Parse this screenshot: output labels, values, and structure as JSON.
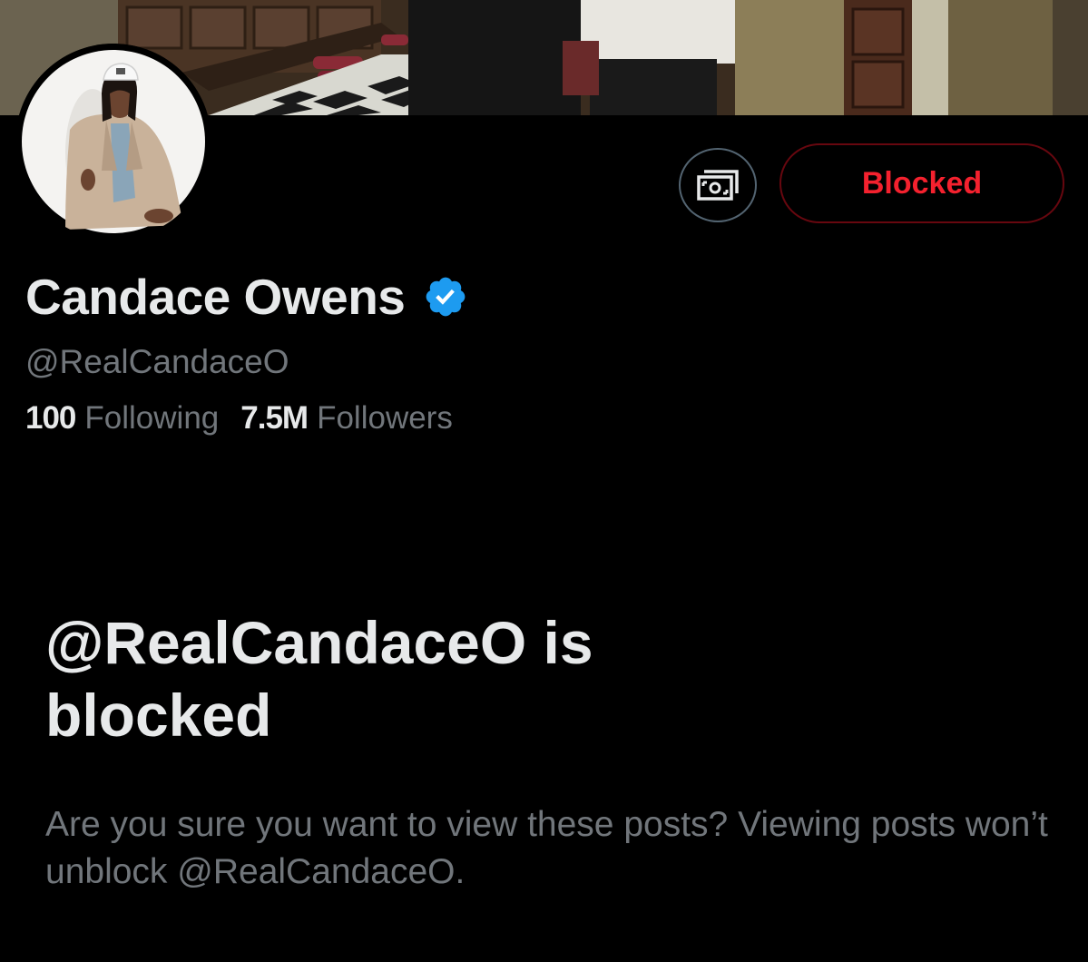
{
  "profile": {
    "display_name": "Candace Owens",
    "handle": "@RealCandaceO",
    "verified": true,
    "following_count": "100",
    "following_label": "Following",
    "followers_count": "7.5M",
    "followers_label": "Followers"
  },
  "actions": {
    "tip_icon": "money-icon",
    "blocked_label": "Blocked"
  },
  "notice": {
    "title": "@RealCandaceO is blocked",
    "message": "Are you sure you want to view these posts? Viewing posts won’t unblock @RealCandaceO."
  },
  "colors": {
    "background": "#000000",
    "primary_text": "#e7e9ea",
    "secondary_text": "#71767b",
    "blocked_red": "#f4212e",
    "blocked_border": "#67070f",
    "verified_blue": "#1d9bf0"
  }
}
